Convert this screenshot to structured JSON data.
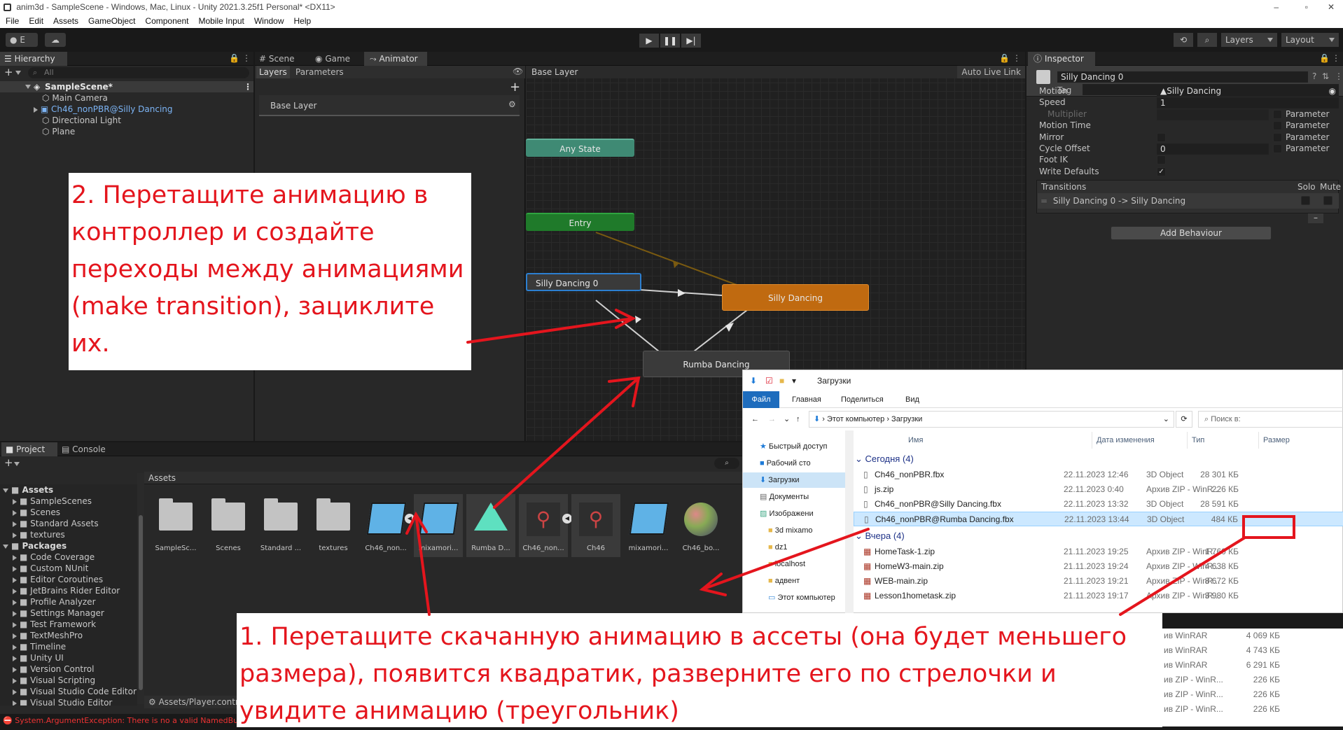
{
  "titlebar": {
    "title": "anim3d - SampleScene - Windows, Mac, Linux - Unity 2021.3.25f1 Personal* <DX11>"
  },
  "menu": [
    "File",
    "Edit",
    "Assets",
    "GameObject",
    "Component",
    "Mobile Input",
    "Window",
    "Help"
  ],
  "toolbar": {
    "account": "E",
    "layers": "Layers",
    "layout": "Layout"
  },
  "hierarchy": {
    "tab": "Hierarchy",
    "search_placeholder": "All",
    "scene": "SampleScene*",
    "items": [
      "Main Camera",
      "Ch46_nonPBR@Silly Dancing",
      "Directional Light",
      "Plane"
    ]
  },
  "center_tabs": [
    "Scene",
    "Game",
    "Animator"
  ],
  "animator": {
    "tab_layers": "Layers",
    "tab_params": "Parameters",
    "base_layer": "Base Layer",
    "breadcrumb": "Base Layer",
    "auto_live": "Auto Live Link",
    "nodes": {
      "any_state": "Any State",
      "entry": "Entry",
      "silly0": "Silly Dancing 0",
      "silly": "Silly Dancing",
      "rumba": "Rumba Dancing"
    }
  },
  "inspector": {
    "tab": "Inspector",
    "name": "Silly Dancing 0",
    "tag": "Tag",
    "props": [
      {
        "label": "Motion",
        "value": "Silly Dancing"
      },
      {
        "label": "Speed",
        "value": "1"
      },
      {
        "label": "Multiplier",
        "value": ""
      },
      {
        "label": "Motion Time",
        "value": ""
      },
      {
        "label": "Mirror",
        "value": ""
      },
      {
        "label": "Cycle Offset",
        "value": "0"
      },
      {
        "label": "Foot IK",
        "value": ""
      },
      {
        "label": "Write Defaults",
        "value": ""
      }
    ],
    "param": "Parameter",
    "transitions": "Transitions",
    "solo": "Solo",
    "mute": "Mute",
    "transition_item": "Silly Dancing 0 -> Silly Dancing",
    "add_behaviour": "Add Behaviour"
  },
  "project": {
    "tab_project": "Project",
    "tab_console": "Console",
    "assets_header": "Assets",
    "tree": [
      {
        "label": "Assets",
        "level": 0
      },
      {
        "label": "SampleScenes",
        "level": 1
      },
      {
        "label": "Scenes",
        "level": 1
      },
      {
        "label": "Standard Assets",
        "level": 1
      },
      {
        "label": "textures",
        "level": 1
      },
      {
        "label": "Packages",
        "level": 0
      },
      {
        "label": "Code Coverage",
        "level": 1
      },
      {
        "label": "Custom NUnit",
        "level": 1
      },
      {
        "label": "Editor Coroutines",
        "level": 1
      },
      {
        "label": "JetBrains Rider Editor",
        "level": 1
      },
      {
        "label": "Profile Analyzer",
        "level": 1
      },
      {
        "label": "Settings Manager",
        "level": 1
      },
      {
        "label": "Test Framework",
        "level": 1
      },
      {
        "label": "TextMeshPro",
        "level": 1
      },
      {
        "label": "Timeline",
        "level": 1
      },
      {
        "label": "Unity UI",
        "level": 1
      },
      {
        "label": "Version Control",
        "level": 1
      },
      {
        "label": "Visual Scripting",
        "level": 1
      },
      {
        "label": "Visual Studio Code Editor",
        "level": 1
      },
      {
        "label": "Visual Studio Editor",
        "level": 1
      }
    ],
    "items": [
      "SampleSc...",
      "Scenes",
      "Standard ...",
      "textures",
      "Ch46_non...",
      "mixamori...",
      "Rumba D...",
      "Ch46_non...",
      "Ch46",
      "mixamori...",
      "Ch46_bo..."
    ],
    "path": "Assets/Player.contro"
  },
  "status": {
    "error": "System.ArgumentException: There is no a valid NamedBu"
  },
  "explorer": {
    "title": "Загрузки",
    "ribbon": [
      "Файл",
      "Главная",
      "Поделиться",
      "Вид"
    ],
    "address": [
      "Этот компьютер",
      "Загрузки"
    ],
    "search": "Поиск в:",
    "nav": [
      "Быстрый доступ",
      "Рабочий сто",
      "Загрузки",
      "Документы",
      "Изображени",
      "3d mixamo",
      "dz1",
      "localhost",
      "адвент",
      "Этот компьютер"
    ],
    "cols": [
      "Имя",
      "Дата изменения",
      "Тип",
      "Размер"
    ],
    "group_today": "Сегодня (4)",
    "group_yesterday": "Вчера (4)",
    "today": [
      {
        "name": "Ch46_nonPBR.fbx",
        "date": "22.11.2023 12:46",
        "type": "3D Object",
        "size": "28 301 КБ"
      },
      {
        "name": "js.zip",
        "date": "22.11.2023 0:40",
        "type": "Архив ZIP - WinR...",
        "size": "226 КБ"
      },
      {
        "name": "Ch46_nonPBR@Silly Dancing.fbx",
        "date": "22.11.2023 13:32",
        "type": "3D Object",
        "size": "28 591 КБ"
      },
      {
        "name": "Ch46_nonPBR@Rumba Dancing.fbx",
        "date": "22.11.2023 13:44",
        "type": "3D Object",
        "size": "484 КБ"
      }
    ],
    "yesterday": [
      {
        "name": "HomeTask-1.zip",
        "date": "21.11.2023 19:25",
        "type": "Архив ZIP - WinR...",
        "size": "1 760 КБ"
      },
      {
        "name": "HomeW3-main.zip",
        "date": "21.11.2023 19:24",
        "type": "Архив ZIP - WinR...",
        "size": "4 638 КБ"
      },
      {
        "name": "WEB-main.zip",
        "date": "21.11.2023 19:21",
        "type": "Архив ZIP - WinR...",
        "size": "8 672 КБ"
      },
      {
        "name": "Lesson1hometask.zip",
        "date": "21.11.2023 19:17",
        "type": "Архив ZIP - WinR...",
        "size": "3 980 КБ"
      }
    ],
    "more": [
      {
        "type": "ив WinRAR",
        "size": "4 069 КБ"
      },
      {
        "type": "ив WinRAR",
        "size": "4 743 КБ"
      },
      {
        "type": "ив WinRAR",
        "size": "6 291 КБ"
      },
      {
        "type": "ив ZIP - WinR...",
        "size": "226 КБ"
      },
      {
        "type": "ив ZIP - WinR...",
        "size": "226 КБ"
      },
      {
        "type": "ив ZIP - WinR...",
        "size": "226 КБ"
      }
    ]
  },
  "annotations": {
    "step2": "2. Перетащите анимацию в контроллер и создайте переходы между анимациями (make transition), зациклите их.",
    "step1": "1. Перетащите скачанную анимацию в ассеты (она будет меньшего размера), появится квадратик, разверните его по стрелочки и увидите анимацию (треугольник)"
  },
  "colors": {
    "accent_red": "#e4151d",
    "any_state": "#3f8a74",
    "entry": "#1f7a2a",
    "default_state": "#c06a10",
    "selection": "#2c5d87"
  }
}
